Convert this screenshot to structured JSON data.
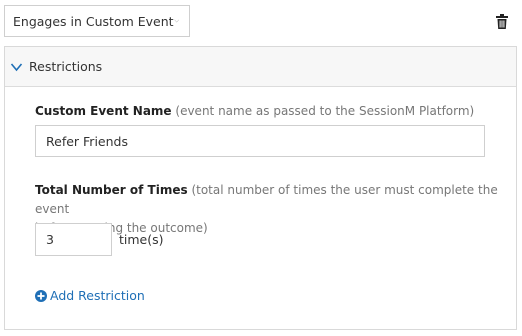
{
  "event_select": {
    "selected": "Engages in Custom Event",
    "chevron_icon": "chevron-down-icon"
  },
  "delete_icon": "trash-icon",
  "restrictions": {
    "title": "Restrictions",
    "expanded": true,
    "custom_event_name": {
      "label": "Custom Event Name",
      "hint": "(event name as passed to the SessionM Platform)",
      "value": "Refer Friends"
    },
    "total_times": {
      "label": "Total Number of Times",
      "hint_line1": "(total number of times the user must complete the event",
      "hint_line2": "before earning the outcome)",
      "value": "3",
      "unit": "time(s)"
    },
    "add_restriction_label": "Add Restriction"
  },
  "colors": {
    "link": "#1f6fb6",
    "border": "#cfcfcf",
    "header_bg": "#f7f7f7"
  }
}
